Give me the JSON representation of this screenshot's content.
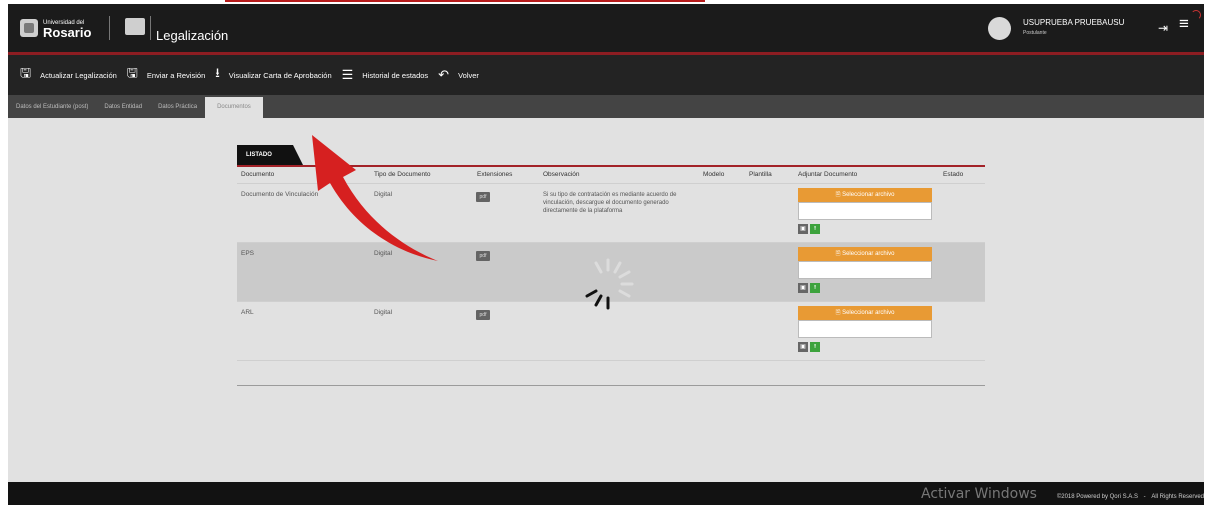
{
  "header": {
    "brand_small": "Universidad del",
    "brand_large": "Rosario",
    "app_title": "Legalización",
    "user_name": "USUPRUEBA PRUEBAUSU",
    "user_role": "Postulante",
    "logout_icon": "logout-icon",
    "menu_icon": "hamburger-menu-icon"
  },
  "toolbar": {
    "actions": [
      {
        "label": "Actualizar Legalización",
        "icon": "save-icon"
      },
      {
        "label": "Enviar a Revisión",
        "icon": "save-icon"
      },
      {
        "label": "Visualizar Carta de Aprobación",
        "icon": "download-icon"
      },
      {
        "label": "Historial de estados",
        "icon": "list-icon"
      },
      {
        "label": "Volver",
        "icon": "undo-icon"
      }
    ]
  },
  "tabs": [
    {
      "label": "Datos del Estudiante (post)",
      "active": false
    },
    {
      "label": "Datos Entidad",
      "active": false
    },
    {
      "label": "Datos Práctica",
      "active": false
    },
    {
      "label": "Documentos",
      "active": true
    }
  ],
  "panel": {
    "tab_label": "LISTADO",
    "columns": [
      "Documento",
      "Tipo de Documento",
      "Extensiones",
      "Observación",
      "Modelo",
      "Plantilla",
      "Adjuntar Documento",
      "Estado"
    ],
    "rows": [
      {
        "documento": "Documento de Vinculación",
        "tipo": "Digital",
        "extension": "pdf",
        "observacion": "Si su tipo de contratación es mediante acuerdo de vinculación, descargue el documento generado directamente de la plataforma",
        "select_label": "Seleccionar archivo"
      },
      {
        "documento": "EPS",
        "tipo": "Digital",
        "extension": "pdf",
        "observacion": "",
        "select_label": "Seleccionar archivo"
      },
      {
        "documento": "ARL",
        "tipo": "Digital",
        "extension": "pdf",
        "observacion": "",
        "select_label": "Seleccionar archivo"
      }
    ]
  },
  "footer": {
    "watermark": "Activar Windows",
    "powered": "©2018 Powered by Qori S.A.S",
    "separator": "-",
    "rights": "All Rights Reserved"
  },
  "colors": {
    "accent_red": "#a32228",
    "select_orange": "#e89a34",
    "upload_green": "#3da33d"
  }
}
